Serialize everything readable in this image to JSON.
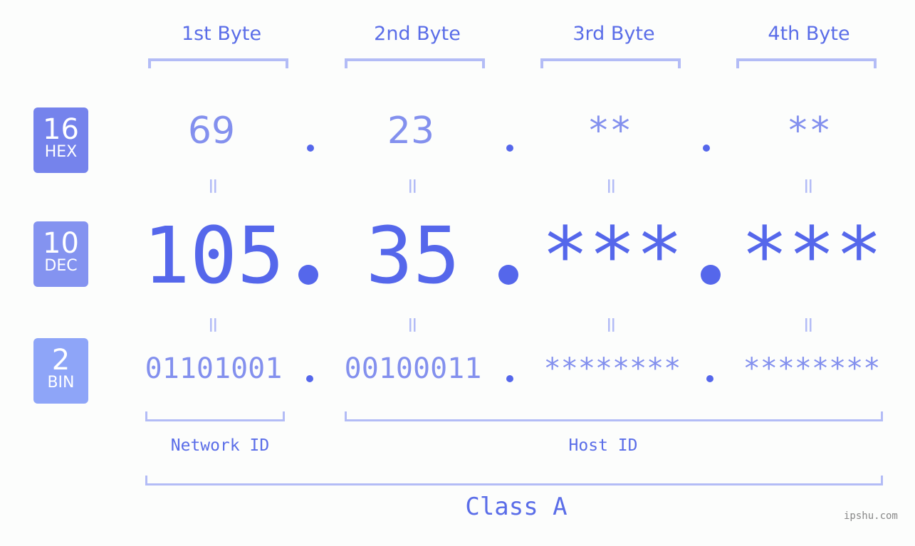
{
  "byte_headers": [
    "1st Byte",
    "2nd Byte",
    "3rd Byte",
    "4th Byte"
  ],
  "badges": {
    "hex": {
      "number": "16",
      "label": "HEX",
      "color": "#7583ec"
    },
    "dec": {
      "number": "10",
      "label": "DEC",
      "color": "#8493f0"
    },
    "bin": {
      "number": "2",
      "label": "BIN",
      "color": "#8ea5f8"
    }
  },
  "hex_values": [
    "69",
    "23",
    "**",
    "**"
  ],
  "dec_values": [
    "105",
    "35",
    "***",
    "***"
  ],
  "bin_values": [
    "01101001",
    "00100011",
    "********",
    "********"
  ],
  "separator": ".",
  "equals": "=",
  "labels": {
    "network_id": "Network ID",
    "host_id": "Host ID",
    "ip_class": "Class A"
  },
  "watermark": "ipshu.com",
  "colors": {
    "primary": "#5567eb",
    "secondary": "#8390ee",
    "bracket": "#b3bcf6"
  }
}
